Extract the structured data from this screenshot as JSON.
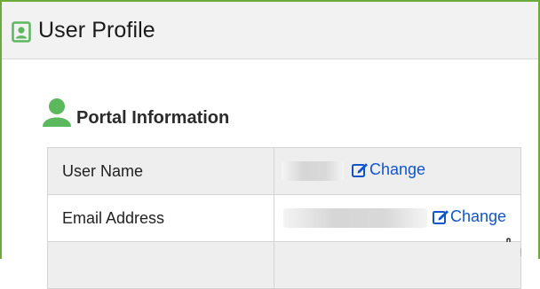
{
  "header": {
    "title": "User Profile",
    "icon": "profile-badge-icon"
  },
  "section": {
    "title": "Portal Information",
    "icon": "user-avatar-icon"
  },
  "colors": {
    "border": "#6cab3a",
    "icon_green": "#5cb85c",
    "link": "#1155cc"
  },
  "rows": [
    {
      "label": "User Name",
      "value": "",
      "action": "Change"
    },
    {
      "label": "Email Address",
      "value": "",
      "action": "Change"
    }
  ]
}
